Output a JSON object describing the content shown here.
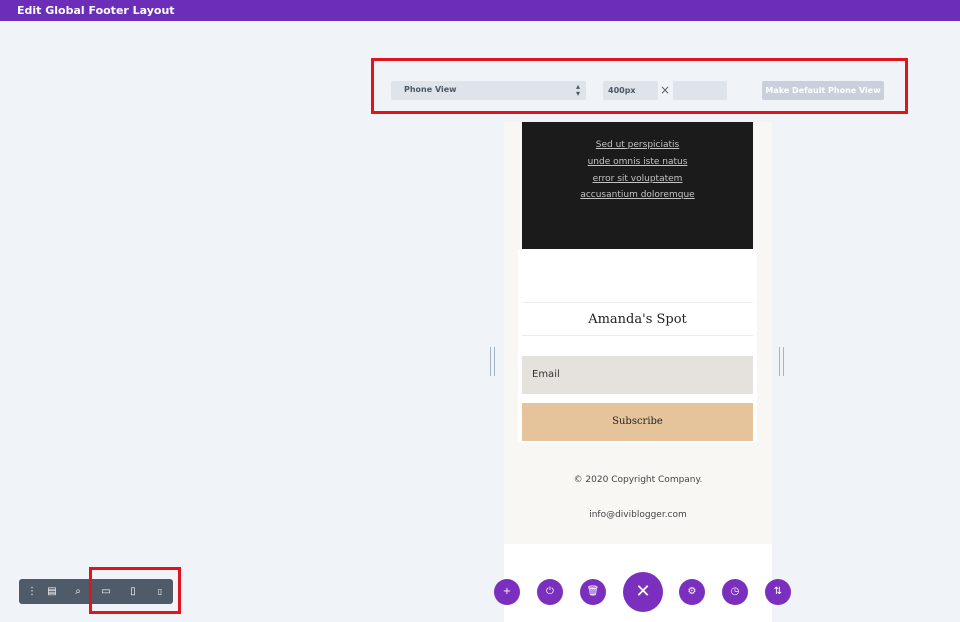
{
  "topbar": {
    "title": "Edit Global Footer Layout"
  },
  "view_bar": {
    "view_select": "Phone View",
    "width_value": "400px",
    "height_value": "",
    "times_symbol": "×",
    "make_default_label": "Make Default Phone View"
  },
  "footer": {
    "links": [
      "Sed ut perspiciatis",
      "unde omnis iste natus",
      "error sit voluptatem",
      "accusantium doloremque"
    ],
    "spot_title": "Amanda's Spot",
    "email_placeholder": "Email",
    "subscribe_label": "Subscribe",
    "copyright": "© 2020 Copyright Company.",
    "contact_email": "info@diviblogger.com"
  },
  "action_buttons": [
    {
      "name": "add",
      "icon": "+"
    },
    {
      "name": "power",
      "icon": "⏻"
    },
    {
      "name": "trash",
      "icon": "🗑"
    },
    {
      "name": "close",
      "icon": "✕"
    },
    {
      "name": "settings",
      "icon": "⚙"
    },
    {
      "name": "history",
      "icon": "◷"
    },
    {
      "name": "portability",
      "icon": "⇅"
    }
  ],
  "toolbar": {
    "icons": [
      "more-vertical",
      "wireframe",
      "zoom",
      "desktop",
      "tablet",
      "phone"
    ],
    "glyphs": {
      "menu": "⋮",
      "wireframe": "▤",
      "zoom": "⌕",
      "desktop": "▭",
      "tablet": "▯",
      "phone": "▯"
    }
  },
  "colors": {
    "purple": "#6c2eb9",
    "button_purple": "#7b2fbe",
    "highlight_red": "#e0141c"
  }
}
